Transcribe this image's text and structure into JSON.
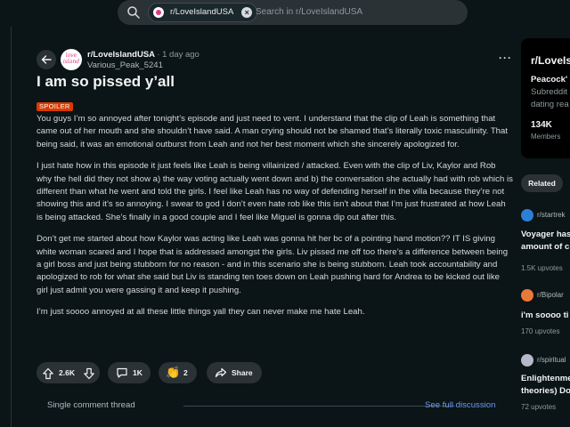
{
  "search": {
    "chip_label": "r/LoveIslandUSA",
    "placeholder": "Search in r/LoveIslandUSA"
  },
  "post": {
    "subreddit": "r/LoveIslandUSA",
    "time": "· 1 day ago",
    "author": "Various_Peak_5241",
    "avatar_text": "love island",
    "title": "I am so pissed y’all",
    "flair": "SPOILER",
    "paragraphs": [
      "You guys I’m so annoyed after tonight’s episode and just need to vent. I understand that the clip of Leah is something that came out of her mouth and she shouldn’t have said. A man crying should not be shamed that’s literally toxic masculinity. That being said, it was an emotional outburst from Leah and not her best moment which she sincerely apologized for.",
      "I just hate how in this episode it just feels like Leah is being villainized / attacked. Even with the clip of Liv, Kaylor and Rob why the hell did they not show a) the way voting actually went down and b) the conversation she actually had with rob which is different than what he went and told the girls. I feel like Leah has no way of defending herself in the villa because they’re not showing this and it’s so annoying. I swear to god I don’t even hate rob like this isn’t about that I’m just frustrated at how Leah is being attacked. She’s finally in a good couple and I feel like Miguel is gonna dip out after this.",
      "Don’t get me started about how Kaylor was acting like Leah was gonna hit her bc of a pointing hand motion?? IT IS giving white woman scared and I hope that is addressed amongst the girls. Liv pissed me off too there’s a difference between being a girl boss and just being stubborn for no reason - and in this scenario she is being stubborn. Leah took accountability and apologized to rob for what she said but Liv is standing ten toes down on Leah pushing hard for Andrea to be kicked out like girl just admit you were gassing it and keep it pushing.",
      "I’m just soooo annoyed at all these little things yall they can never make me hate Leah."
    ],
    "votes": "2.6K",
    "comments": "1K",
    "awards": "2",
    "share_label": "Share"
  },
  "thread": {
    "single_label": "Single comment thread",
    "full_label": "See full discussion"
  },
  "sidebar": {
    "community_name": "r/LoveIs",
    "heading": "Peacock'",
    "desc_line1": "Subreddit",
    "desc_line2": "dating rea",
    "members_count": "134K",
    "members_label": "Members",
    "related_label": "Related",
    "related_posts": [
      {
        "sub": "r/startrek",
        "line1": "Voyager has",
        "line2": "amount of c",
        "upvotes": "1.5K upvotes",
        "avatar_color": "#2d7fd6"
      },
      {
        "sub": "r/Bipolar",
        "line1": "i'm soooo ti",
        "line2": "",
        "upvotes": "170 upvotes",
        "avatar_color": "#e8793a"
      },
      {
        "sub": "r/spiritual",
        "line1": "Enlightenme",
        "line2": "theories) Do",
        "upvotes": "72 upvotes",
        "avatar_color": "#b8b8c8"
      }
    ]
  },
  "colors": {
    "background": "#0b1416",
    "accent_link": "#6c9bf5",
    "spoiler": "#d93a00"
  }
}
